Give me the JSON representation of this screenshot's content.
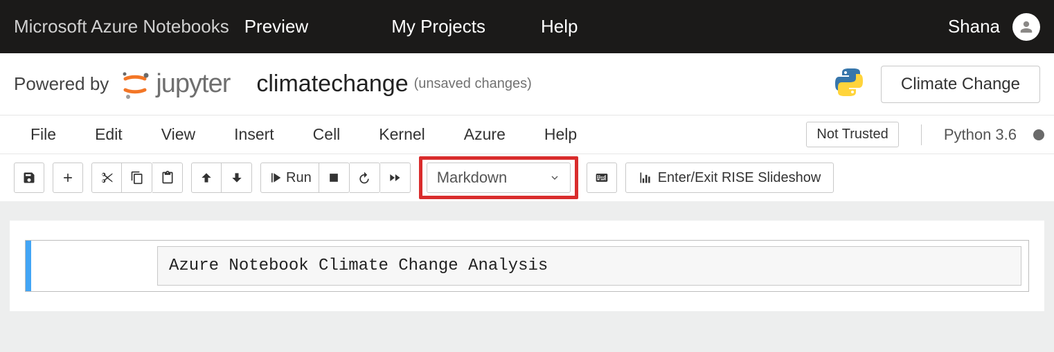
{
  "azureBar": {
    "brand": "Microsoft Azure Notebooks",
    "preview": "Preview",
    "myProjects": "My Projects",
    "help": "Help",
    "user": "Shana"
  },
  "header": {
    "poweredBy": "Powered by",
    "jupyter": "jupyter",
    "notebookTitle": "climatechange",
    "saveStatus": "(unsaved changes)",
    "projectButton": "Climate Change"
  },
  "menu": {
    "items": [
      "File",
      "Edit",
      "View",
      "Insert",
      "Cell",
      "Kernel",
      "Azure",
      "Help"
    ],
    "trusted": "Not Trusted",
    "kernel": "Python 3.6"
  },
  "toolbar": {
    "runLabel": "Run",
    "cellTypeSelected": "Markdown",
    "riseLabel": "Enter/Exit RISE Slideshow"
  },
  "cell": {
    "content": "Azure Notebook Climate Change Analysis"
  }
}
